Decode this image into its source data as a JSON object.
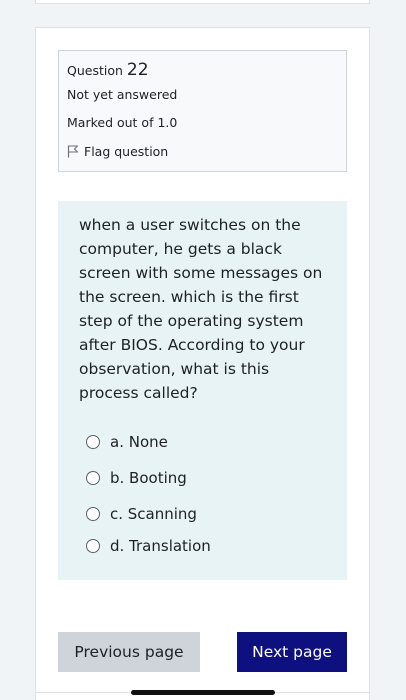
{
  "question_info": {
    "label": "Question",
    "number": "22",
    "status": "Not yet answered",
    "marks": "Marked out of 1.0",
    "flag_label": "Flag question",
    "flag_icon": "flag-icon"
  },
  "question": {
    "text": "when a user switches on the computer, he gets a black screen with some messages on the screen. which is the first step of the operating system after BIOS. According to your observation, what is this process called?",
    "options": [
      "a. None",
      "b. Booting",
      "c. Scanning",
      "d. Translation"
    ]
  },
  "navigation": {
    "previous_label": "Previous page",
    "next_label": "Next page"
  },
  "colors": {
    "page_bg": "#f0f4f7",
    "question_bg": "#e7f3f5",
    "info_bg": "#f8f9fa",
    "next_button": "#0f1080",
    "prev_button": "#ced4da"
  }
}
